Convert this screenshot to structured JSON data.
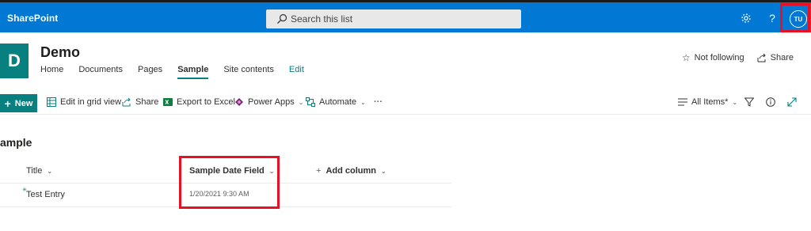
{
  "suitebar": {
    "brand": "SharePoint",
    "search_placeholder": "Search this list",
    "settings_icon": "gear-icon",
    "help_label": "?",
    "avatar_initials": "TU"
  },
  "site": {
    "logo_letter": "D",
    "title": "Demo",
    "nav": [
      {
        "label": "Home"
      },
      {
        "label": "Documents"
      },
      {
        "label": "Pages"
      },
      {
        "label": "Sample"
      },
      {
        "label": "Site contents"
      },
      {
        "label": "Edit"
      }
    ],
    "active_nav": "Sample",
    "follow_label": "Not following",
    "share_label": "Share"
  },
  "commandbar": {
    "new_label": "New",
    "grid_view_label": "Edit in grid view",
    "share_label": "Share",
    "export_label": "Export to Excel",
    "powerapps_label": "Power Apps",
    "automate_label": "Automate",
    "more_label": "···",
    "view_label": "All Items*"
  },
  "list": {
    "title": "ample",
    "columns": {
      "title": "Title",
      "date": "Sample Date Field",
      "add": "Add column"
    },
    "rows": [
      {
        "title": "Test Entry",
        "date": "1/20/2021 9:30 AM"
      }
    ]
  },
  "colors": {
    "suitebar": "#0078d4",
    "theme": "#07807f",
    "highlight": "#e81123"
  }
}
